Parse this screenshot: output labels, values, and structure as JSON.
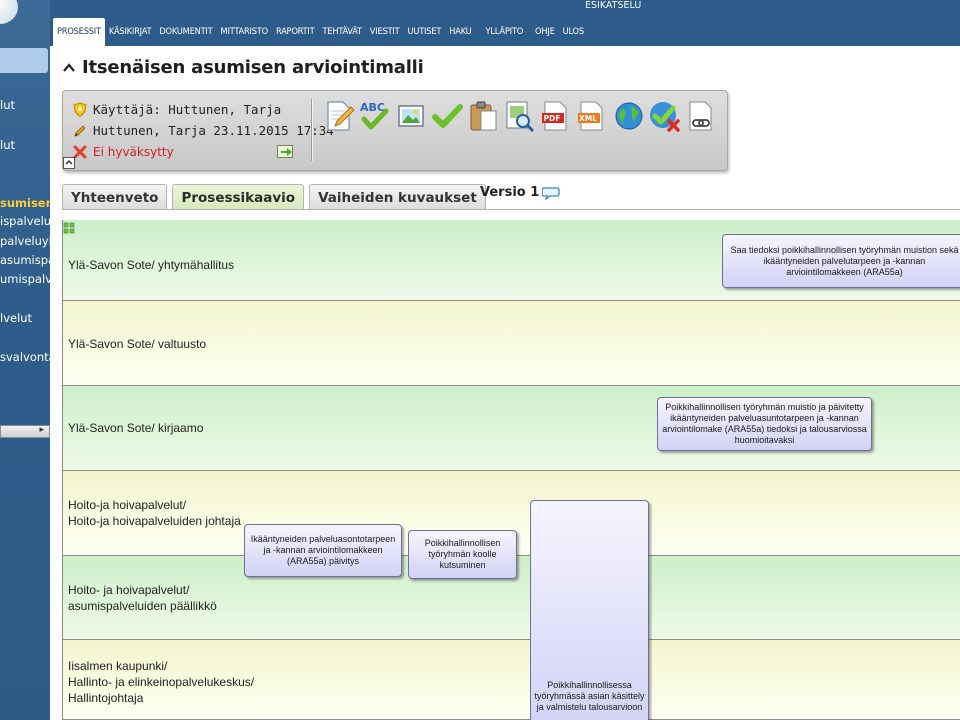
{
  "app": {
    "preview_label": "ESIKATSELU"
  },
  "nav": {
    "items": [
      {
        "label": "PROSESSIT",
        "active": true
      },
      {
        "label": "KÄSIKIRJAT"
      },
      {
        "label": "DOKUMENTIT"
      },
      {
        "label": "MITTARISTO"
      },
      {
        "label": "RAPORTIT"
      },
      {
        "label": "TEHTÄVÄT"
      },
      {
        "label": "VIESTIT"
      },
      {
        "label": "UUTISET"
      },
      {
        "label": "HAKU"
      },
      {
        "label": "YLLÄPITO"
      },
      {
        "label": "OHJE"
      },
      {
        "label": "ULOS"
      }
    ]
  },
  "sidebar": {
    "items": [
      {
        "label": "lut"
      },
      {
        "label": "lut"
      },
      {
        "label": "sumisen a",
        "active": true
      },
      {
        "label": "ispalveluy"
      },
      {
        "label": "palveluyks"
      },
      {
        "label": "asumispa"
      },
      {
        "label": "umispalve"
      },
      {
        "label": "lvelut"
      },
      {
        "label": "svalvonta"
      }
    ]
  },
  "page": {
    "title": "Itsenäisen asumisen arviointimalli",
    "user_line": "Käyttäjä: Huttunen, Tarja",
    "edit_line": "Huttunen, Tarja 23.11.2015 17:34",
    "status": "Ei hyväksytty"
  },
  "toolbar": {
    "tools": [
      {
        "icon": "edit-document-icon"
      },
      {
        "icon": "spellcheck-icon",
        "text": "ABC"
      },
      {
        "icon": "image-icon"
      },
      {
        "icon": "approve-check-icon"
      },
      {
        "icon": "clipboard-icon"
      },
      {
        "icon": "document-search-icon"
      },
      {
        "icon": "pdf-export-icon",
        "text": "PDF"
      },
      {
        "icon": "xml-export-icon",
        "text": "XML"
      },
      {
        "icon": "globe-icon"
      },
      {
        "icon": "reject-approval-icon"
      },
      {
        "icon": "link-document-icon"
      }
    ]
  },
  "tabs": [
    {
      "label": "Yhteenveto"
    },
    {
      "label": "Prosessikaavio",
      "active": true
    },
    {
      "label": "Vaiheiden kuvaukset"
    }
  ],
  "version_label": "Versio 1",
  "lanes": [
    {
      "label": "Ylä-Savon Sote/ yhtymähallitus",
      "color": "green"
    },
    {
      "label": "Ylä-Savon Sote/ valtuusto",
      "color": "yellow"
    },
    {
      "label": "Ylä-Savon Sote/ kirjaamo",
      "color": "green"
    },
    {
      "label": "Hoito-ja hoivapalvelut/\nHoito-ja hoivapalveluiden johtaja",
      "color": "yellow"
    },
    {
      "label": "Hoito- ja hoivapalvelut/\nasumispalveluiden päällikkö",
      "color": "green"
    },
    {
      "label": "Iisalmen kaupunki/\nHallinto- ja elinkeinopalvelukeskus/\nHallintojohtaja",
      "color": "yellow"
    }
  ],
  "tasks": [
    {
      "text": "Saa tiedoksi poikkihallinnollisen työryhmän muistion sekä ikääntyneiden palvelutarpeen ja -kannan arviointilomakkeen (ARA55a)"
    },
    {
      "text": "Poikkihallinnollisen työryhmän muistio ja päivitetty ikääntyneiden palveluasuntotarpeen ja -kannan arviointilomake (ARA55a) tiedoksi ja talousarviossa huomioitavaksi"
    },
    {
      "text": "Ikääntyneiden palveluasontotarpeen ja -kannan arviointilomakkeen (ARA55a) päivitys"
    },
    {
      "text": "Poikkihallinnollisen työryhmän koolle kutsuminen"
    },
    {
      "text": "Poikkihallinnollisessa työryhmässä asian käsittely ja valmistelu talousarvioon"
    }
  ],
  "colors": {
    "nav_bg": "#2e5c8a",
    "lane_green": "#d8f2d3",
    "lane_yellow": "#f7f9dc",
    "task_fill": "#dcdcf8",
    "status_red": "#d82020"
  }
}
